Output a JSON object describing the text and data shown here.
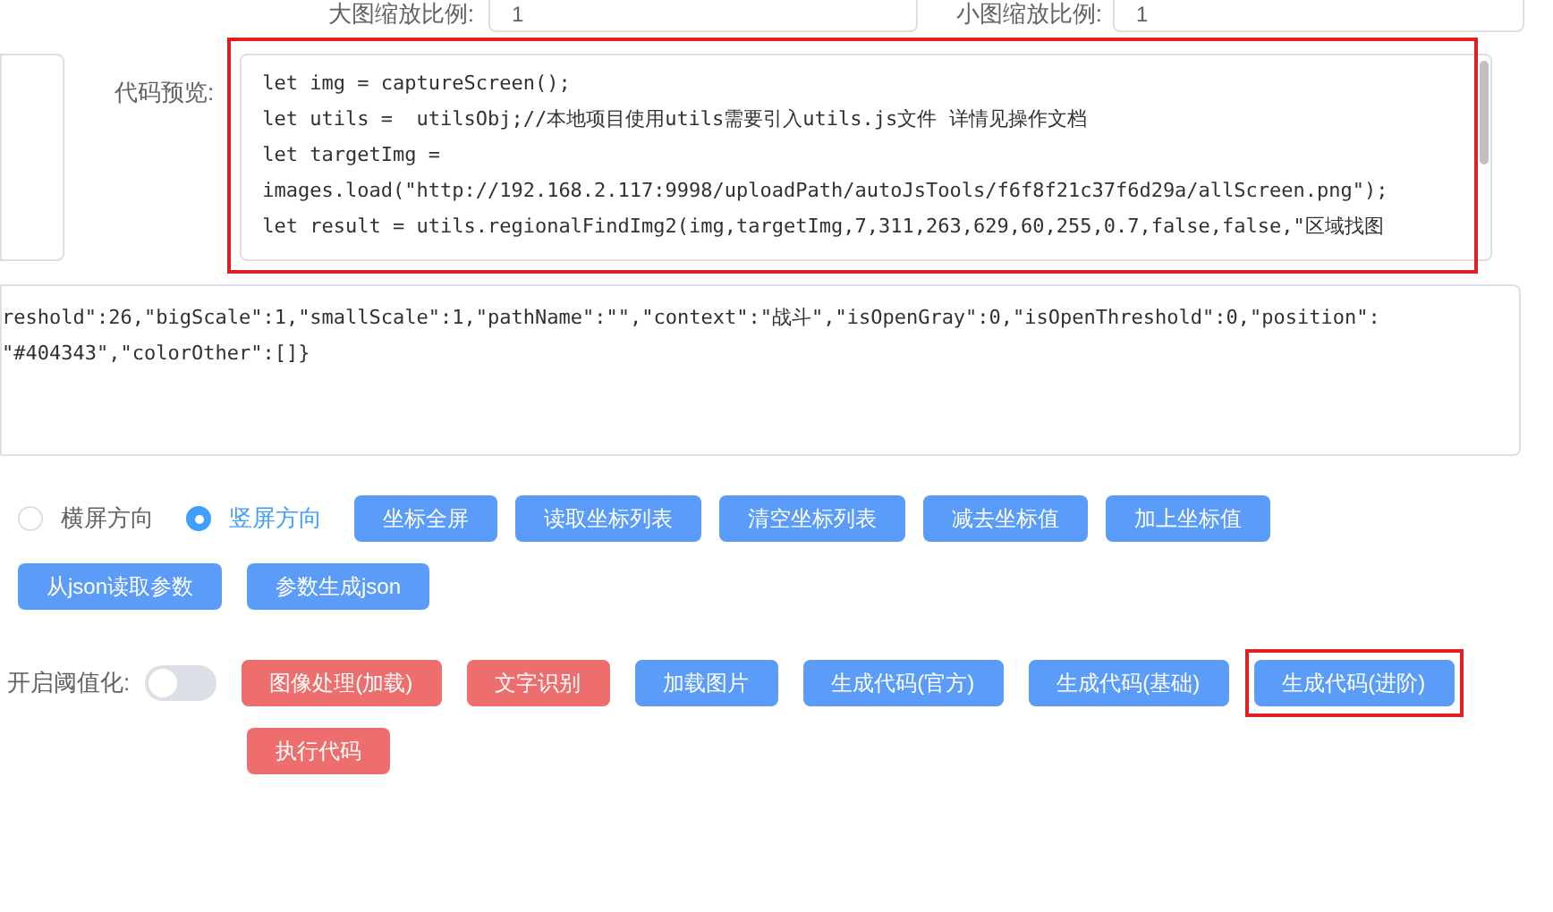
{
  "scale_fields": [
    {
      "label": "大图缩放比例:",
      "value": "1"
    },
    {
      "label": "小图缩放比例:",
      "value": "1"
    }
  ],
  "code_preview": {
    "label": "代码预览:",
    "highlighted": true,
    "lines": [
      "let img = captureScreen();",
      "let utils =  utilsObj;//本地项目使用utils需要引入utils.js文件 详情见操作文档",
      "let targetImg =",
      "images.load(\"http://192.168.2.117:9998/uploadPath/autoJsTools/f6f8f21c37f6d29a/allScreen.png\");",
      "let result = utils.regionalFindImg2(img,targetImg,7,311,263,629,60,255,0.7,false,false,\"区域找图"
    ]
  },
  "json_lines": [
    "reshold\":26,\"bigScale\":1,\"smallScale\":1,\"pathName\":\"\",\"context\":\"战斗\",\"isOpenGray\":0,\"isOpenThreshold\":0,\"position\":",
    "\"#404343\",\"colorOther\":[]}"
  ],
  "orientation": [
    {
      "label": "横屏方向",
      "selected": false
    },
    {
      "label": "竖屏方向",
      "selected": true
    }
  ],
  "coord_buttons": [
    {
      "label": "坐标全屏",
      "kind": "primary"
    },
    {
      "label": "读取坐标列表",
      "kind": "primary"
    },
    {
      "label": "清空坐标列表",
      "kind": "primary"
    },
    {
      "label": "减去坐标值",
      "kind": "primary"
    },
    {
      "label": "加上坐标值",
      "kind": "primary"
    },
    {
      "label": "从json读取参数",
      "kind": "primary"
    },
    {
      "label": "参数生成json",
      "kind": "primary"
    }
  ],
  "threshold": {
    "label": "开启阈值化:",
    "on": false
  },
  "action_buttons": [
    {
      "label": "图像处理(加载)",
      "kind": "danger",
      "highlighted": false
    },
    {
      "label": "文字识别",
      "kind": "danger",
      "highlighted": false
    },
    {
      "label": "加载图片",
      "kind": "primary",
      "highlighted": false
    },
    {
      "label": "生成代码(官方)",
      "kind": "primary",
      "highlighted": false
    },
    {
      "label": "生成代码(基础)",
      "kind": "primary",
      "highlighted": false
    },
    {
      "label": "生成代码(进阶)",
      "kind": "primary",
      "highlighted": true
    },
    {
      "label": "执行代码",
      "kind": "danger",
      "highlighted": false
    }
  ]
}
